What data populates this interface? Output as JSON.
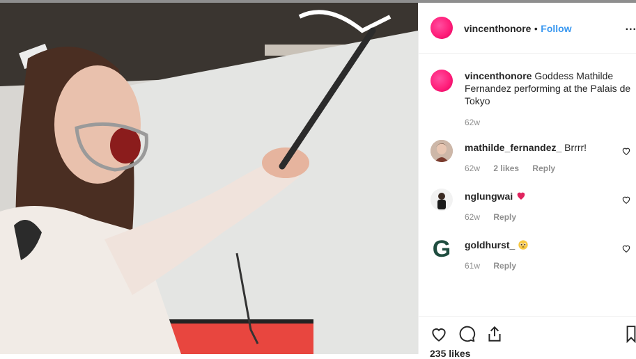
{
  "post": {
    "author": "vincenthonore",
    "follow_label": "Follow",
    "separator": "•",
    "more_label": "...",
    "caption_text": "Goddess Mathilde Fernandez performing at the Palais de Tokyo",
    "caption_age": "62w",
    "likes": "235 likes"
  },
  "comments": [
    {
      "user": "mathilde_fernandez_",
      "text": "Brrrr!",
      "age": "62w",
      "likes": "2 likes",
      "reply": "Reply"
    },
    {
      "user": "nglungwai",
      "text": "",
      "emoji": "red-heart",
      "age": "62w",
      "reply": "Reply"
    },
    {
      "user": "goldhurst_",
      "text": "",
      "emoji": "pleading-face",
      "avatar_letter": "G",
      "age": "61w",
      "reply": "Reply"
    }
  ],
  "icons": [
    "heart-icon",
    "comment-icon",
    "share-icon",
    "bookmark-icon"
  ],
  "colors": {
    "follow": "#3897f0",
    "meta": "#8e8e8e",
    "avatar_pink": "#ff1f7a",
    "heart_red": "#e0245e",
    "goldhurst_g": "#1f4d3f"
  }
}
